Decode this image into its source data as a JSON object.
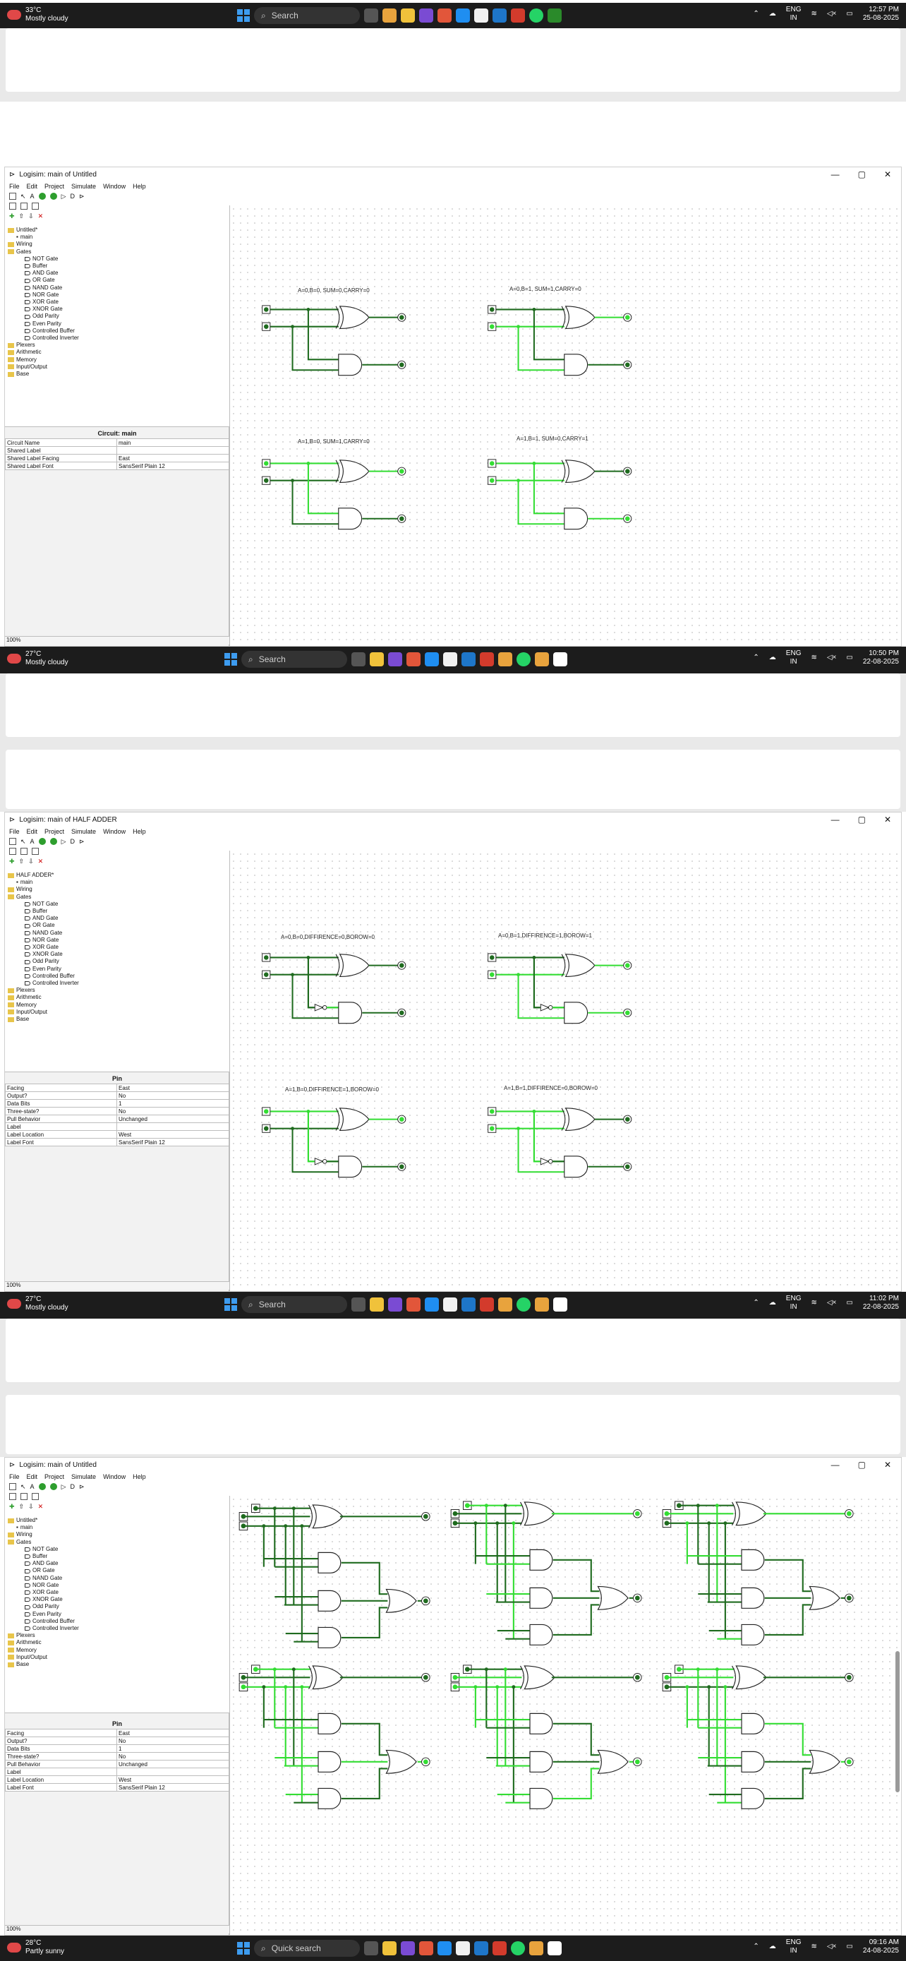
{
  "taskbars": [
    {
      "temp": "33°C",
      "cond": "Mostly cloudy",
      "search": "Search",
      "lang1": "ENG",
      "lang2": "IN",
      "time": "12:57 PM",
      "date": "25-08-2025"
    },
    {
      "temp": "27°C",
      "cond": "Mostly cloudy",
      "search": "Search",
      "lang1": "ENG",
      "lang2": "IN",
      "time": "10:50 PM",
      "date": "22-08-2025"
    },
    {
      "temp": "27°C",
      "cond": "Mostly cloudy",
      "search": "Search",
      "lang1": "ENG",
      "lang2": "IN",
      "time": "11:02 PM",
      "date": "22-08-2025"
    },
    {
      "temp": "28°C",
      "cond": "Partly sunny",
      "search": "Quick search",
      "lang1": "ENG",
      "lang2": "IN",
      "time": "09:16 AM",
      "date": "24-08-2025"
    }
  ],
  "menu": {
    "file": "File",
    "edit": "Edit",
    "project": "Project",
    "simulate": "Simulate",
    "window": "Window",
    "help": "Help"
  },
  "zoom": "100%",
  "gates": [
    "NOT Gate",
    "Buffer",
    "AND Gate",
    "OR Gate",
    "NAND Gate",
    "NOR Gate",
    "XOR Gate",
    "XNOR Gate",
    "Odd Parity",
    "Even Parity",
    "Controlled Buffer",
    "Controlled Inverter"
  ],
  "libs": [
    "Plexers",
    "Arithmetic",
    "Memory",
    "Input/Output",
    "Base"
  ],
  "windows": [
    {
      "title": "Logisim: main of Untitled",
      "project": "Untitled*",
      "attr_title": "Circuit: main",
      "attrs": [
        [
          "Circuit Name",
          "main"
        ],
        [
          "Shared Label",
          ""
        ],
        [
          "Shared Label Facing",
          "East"
        ],
        [
          "Shared Label Font",
          "SansSerif Plain 12"
        ]
      ],
      "labels": [
        "A=0,B=0, SUM=0,CARRY=0",
        "A=0,B=1, SUM=1,CARRY=0",
        "A=1,B=0, SUM=1,CARRY=0",
        "A=1,B=1, SUM=0,CARRY=1"
      ]
    },
    {
      "title": "Logisim: main of HALF ADDER",
      "project": "HALF ADDER*",
      "attr_title": "Pin",
      "attrs": [
        [
          "Facing",
          "East"
        ],
        [
          "Output?",
          "No"
        ],
        [
          "Data Bits",
          "1"
        ],
        [
          "Three-state?",
          "No"
        ],
        [
          "Pull Behavior",
          "Unchanged"
        ],
        [
          "Label",
          ""
        ],
        [
          "Label Location",
          "West"
        ],
        [
          "Label Font",
          "SansSerif Plain 12"
        ]
      ],
      "labels": [
        "A=0,B=0,DIFFIRENCE=0,BOROW=0",
        "A=0,B=1,DIFFIRENCE=1,BOROW=1",
        "A=1,B=0,DIFFIRENCE=1,BOROW=0",
        "A=1,B=1,DIFFIRENCE=0,BOROW=0"
      ]
    },
    {
      "title": "Logisim: main of Untitled",
      "project": "Untitled*",
      "attr_title": "Pin",
      "attrs": [
        [
          "Facing",
          "East"
        ],
        [
          "Output?",
          "No"
        ],
        [
          "Data Bits",
          "1"
        ],
        [
          "Three-state?",
          "No"
        ],
        [
          "Pull Behavior",
          "Unchanged"
        ],
        [
          "Label",
          ""
        ],
        [
          "Label Location",
          "West"
        ],
        [
          "Label Font",
          "SansSerif Plain 12"
        ]
      ],
      "labels": []
    }
  ],
  "colors": {
    "wire_on": "#33dd33",
    "wire_off": "#1f6b1f",
    "taskbar": "#1c1c1c"
  }
}
